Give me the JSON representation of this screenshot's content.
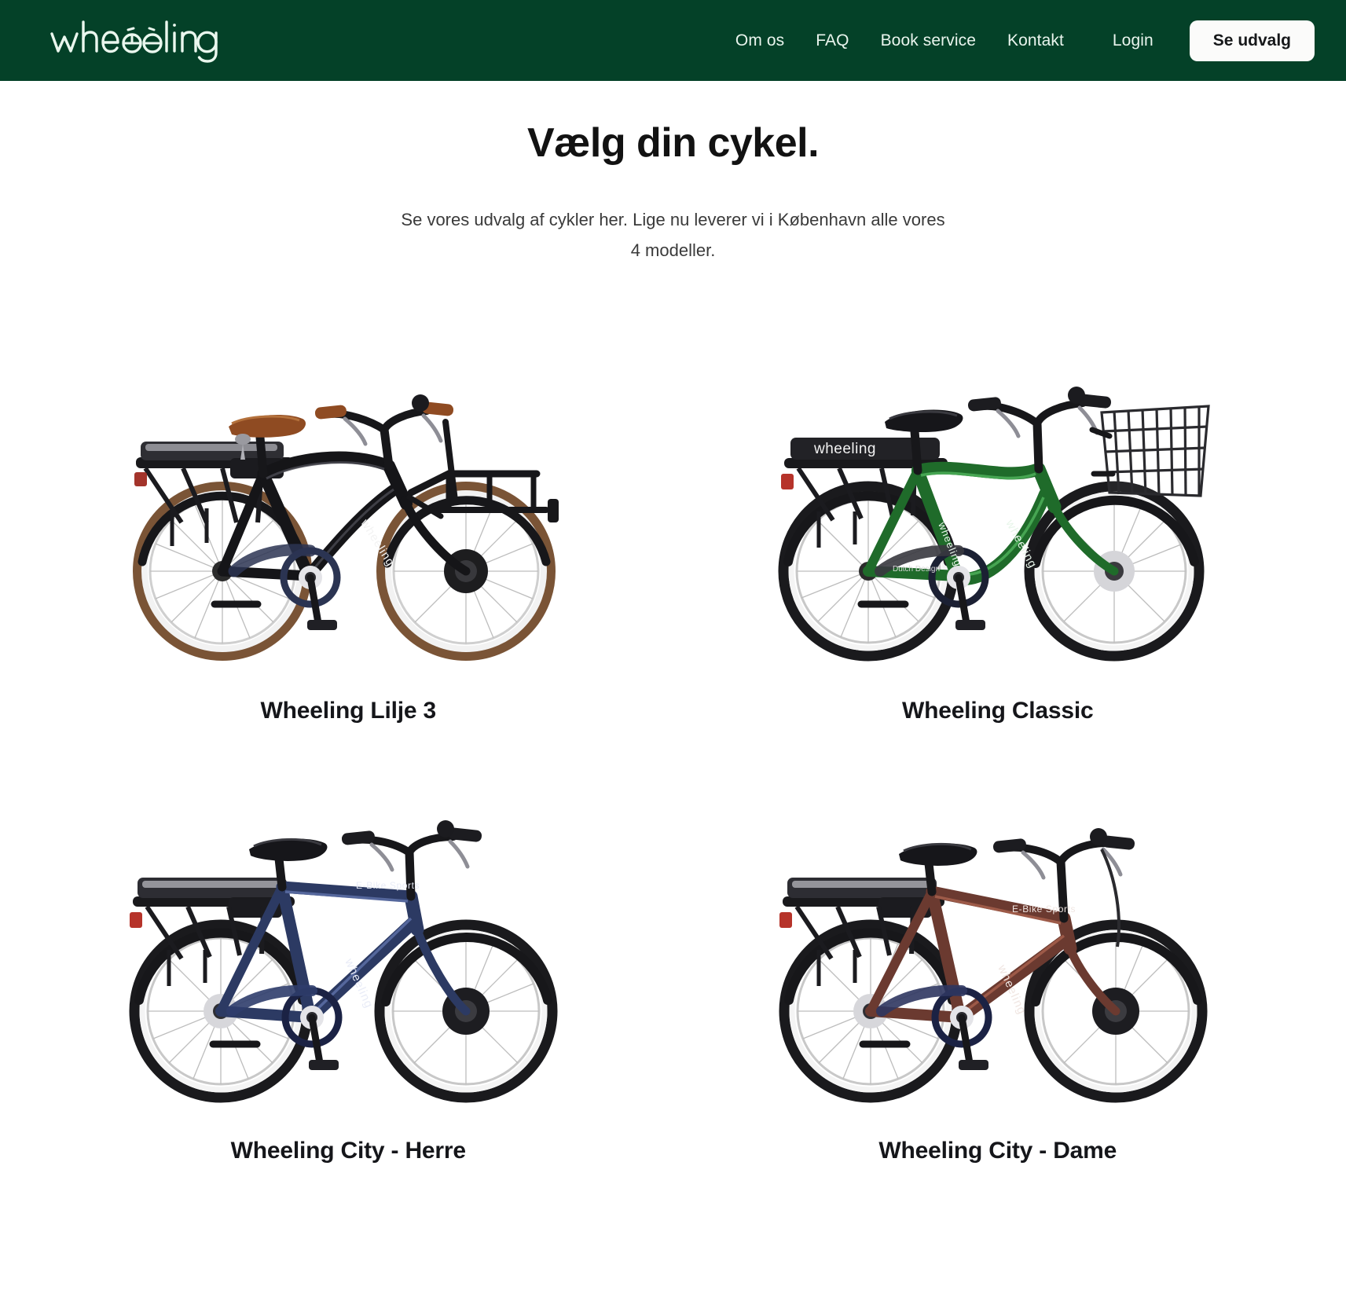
{
  "brand": {
    "name": "wheeling",
    "header_bg": "#044128",
    "logo_color": "#eaf7ee"
  },
  "header": {
    "nav": [
      {
        "label": "Om os",
        "name": "nav-om-os"
      },
      {
        "label": "FAQ",
        "name": "nav-faq"
      },
      {
        "label": "Book service",
        "name": "nav-book-service"
      },
      {
        "label": "Kontakt",
        "name": "nav-kontakt"
      },
      {
        "label": "Login",
        "name": "nav-login"
      }
    ],
    "cta_label": "Se udvalg"
  },
  "hero": {
    "title": "Vælg din cykel.",
    "subtitle": "Se vores udvalg af cykler her. Lige nu leverer vi i København alle vores 4 modeller."
  },
  "products": [
    {
      "title": "Wheeling Lilje 3",
      "frame_color": "#151518",
      "frame_highlight": "#3b3b42",
      "accent_color": "#8a4a22",
      "tire_wall": "#7a5436",
      "saddle_color": "#8f4b22",
      "has_front_rack": true,
      "has_basket": false,
      "frame_style": "step-through",
      "decal": "wheeling"
    },
    {
      "title": "Wheeling Classic",
      "frame_color": "#1f6b2a",
      "frame_highlight": "#2f8c38",
      "accent_color": "#1a1a1a",
      "tire_wall": "#1a1a1a",
      "saddle_color": "#16161a",
      "has_front_rack": false,
      "has_basket": true,
      "frame_style": "low-step",
      "decal": "wheeling"
    },
    {
      "title": "Wheeling City - Herre",
      "frame_color": "#2c3a63",
      "frame_highlight": "#415489",
      "accent_color": "#1a1a1a",
      "tire_wall": "#1a1a1a",
      "saddle_color": "#16161a",
      "has_front_rack": false,
      "has_basket": false,
      "frame_style": "diamond",
      "decal": "wheeling"
    },
    {
      "title": "Wheeling City - Dame",
      "frame_color": "#6b3a30",
      "frame_highlight": "#8d4d3e",
      "accent_color": "#1a1a1a",
      "tire_wall": "#1a1a1a",
      "saddle_color": "#16161a",
      "has_front_rack": false,
      "has_basket": false,
      "frame_style": "trapeze",
      "decal": "wheeling"
    }
  ]
}
